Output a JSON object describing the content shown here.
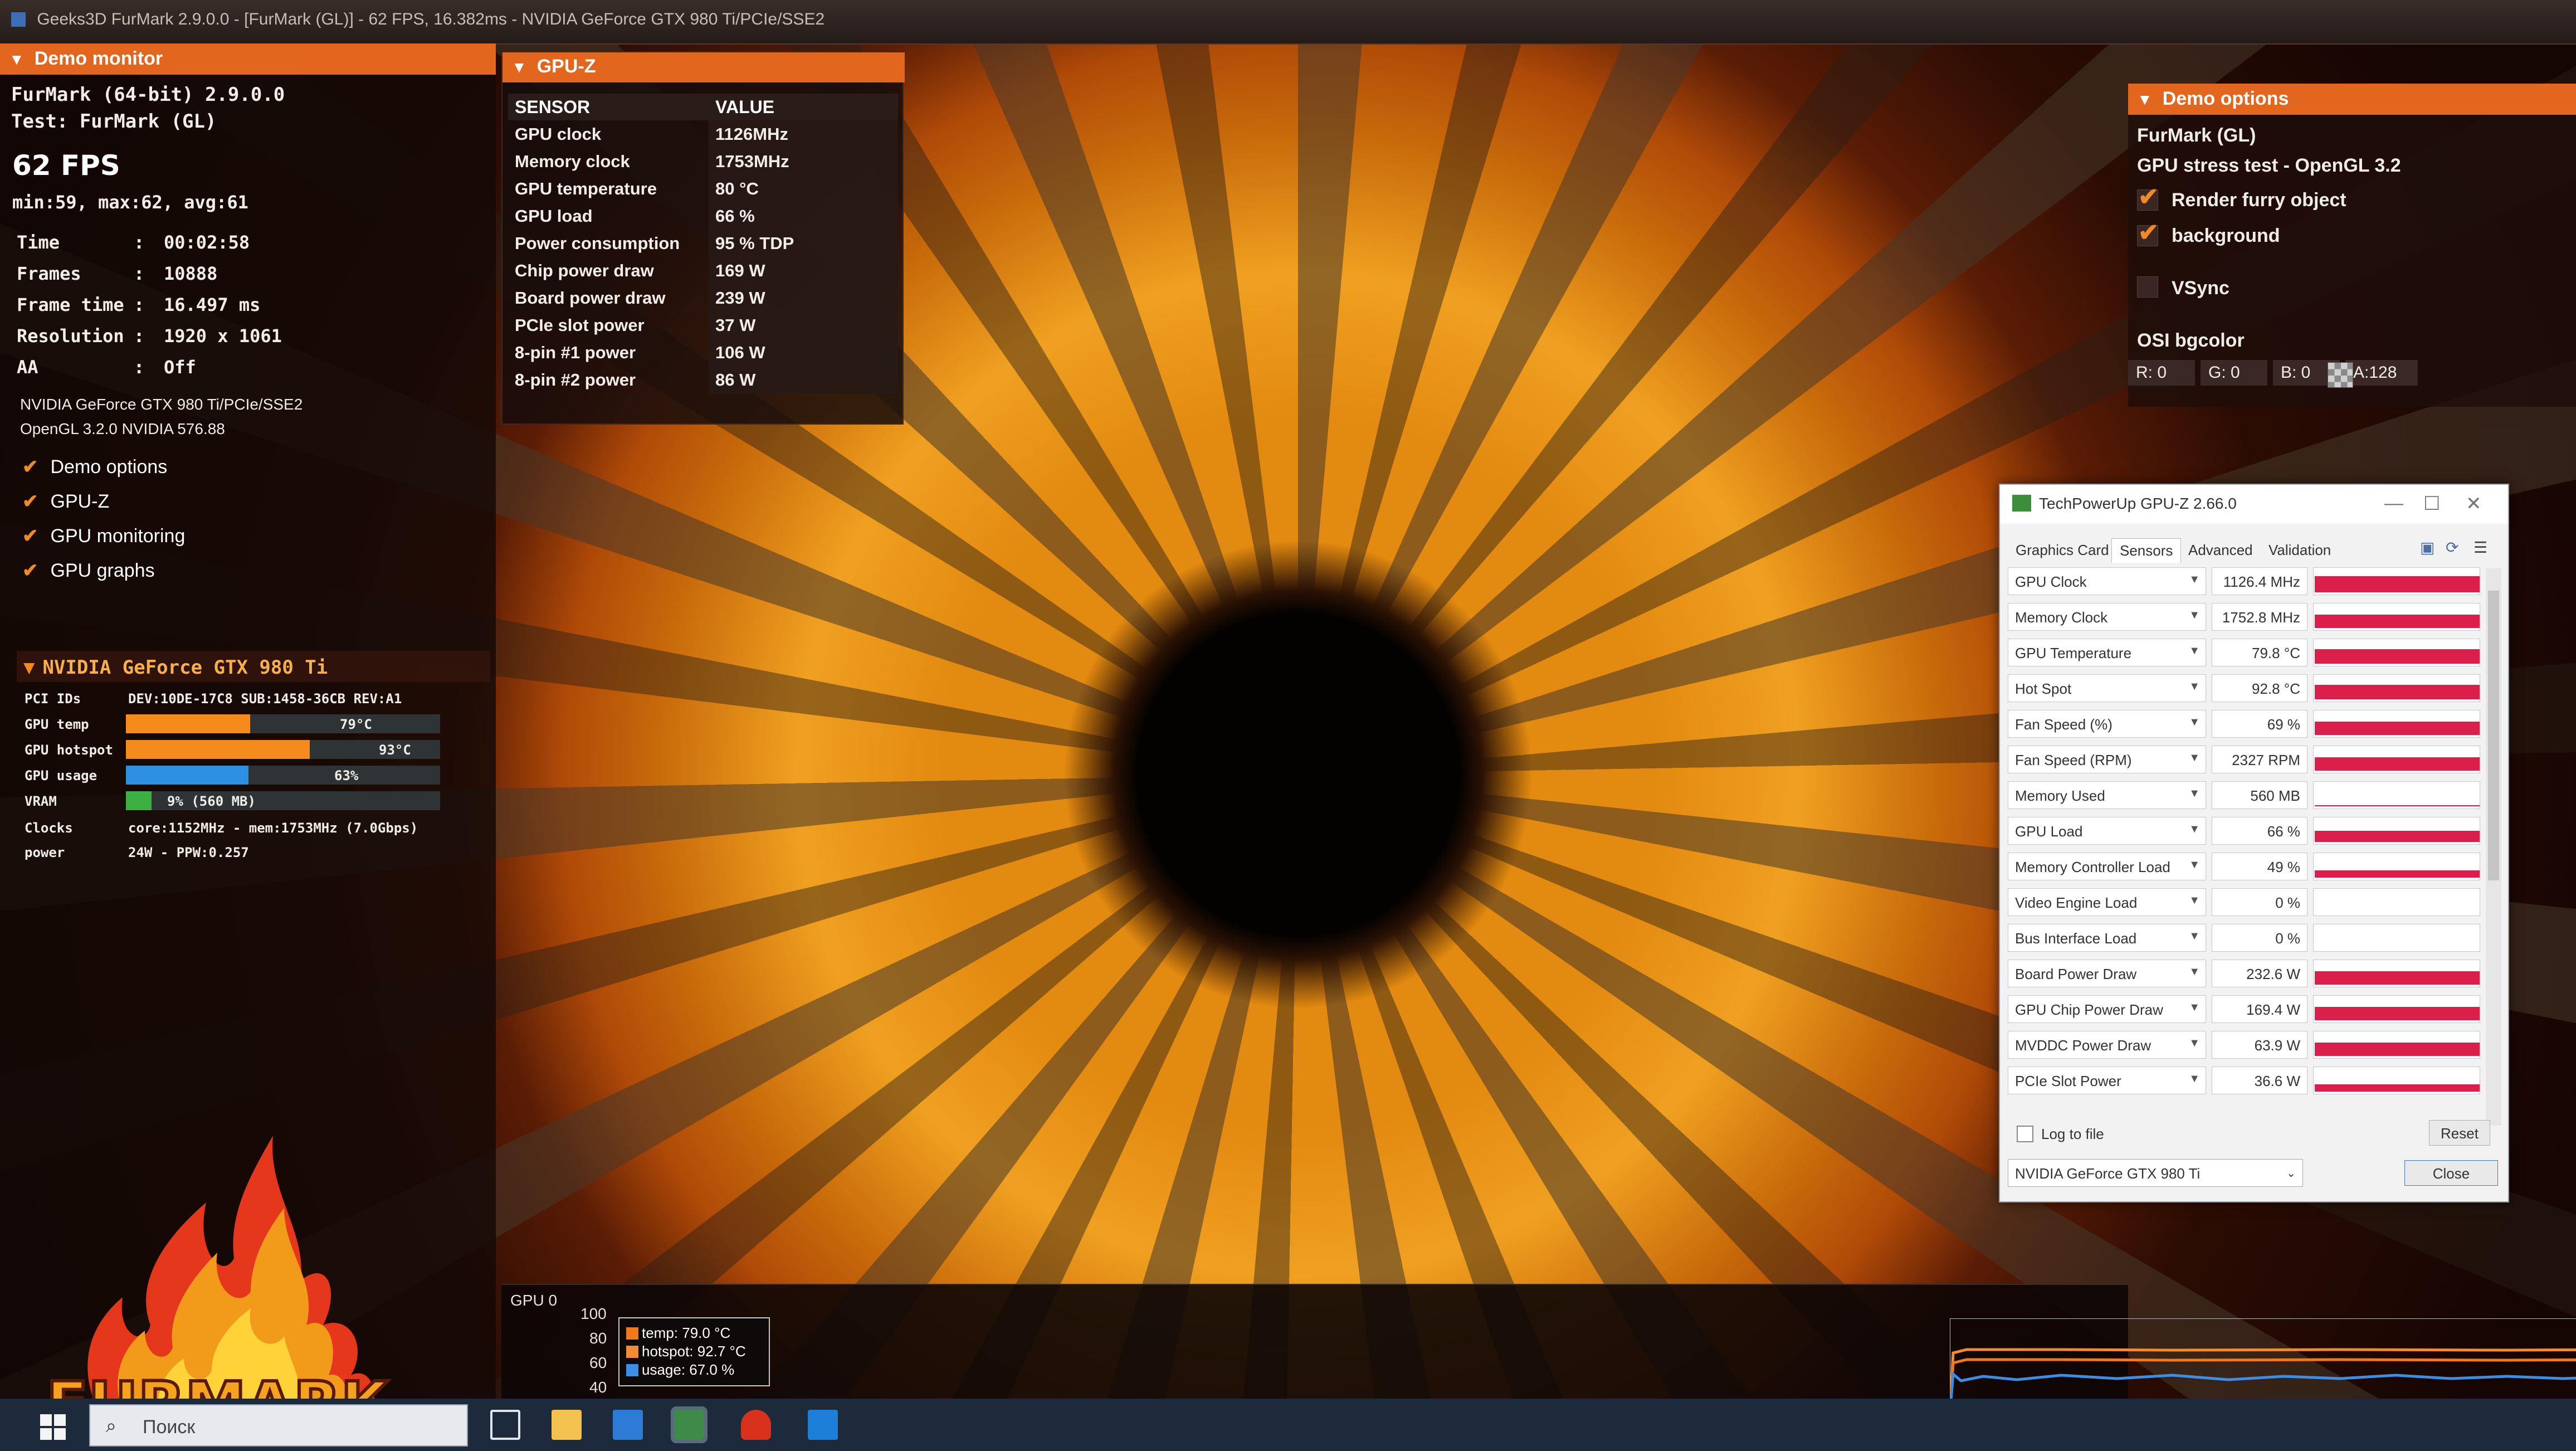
{
  "window": {
    "title": "Geeks3D FurMark 2.9.0.0 - [FurMark (GL)] - 62 FPS, 16.382ms - NVIDIA GeForce GTX 980 Ti/PCIe/SSE2"
  },
  "demo_monitor": {
    "header": "Demo monitor",
    "app_version": "FurMark (64-bit) 2.9.0.0",
    "test": "Test: FurMark (GL)",
    "fps": "62 FPS",
    "minmax": "min:59, max:62, avg:61",
    "stats": [
      {
        "label": "Time",
        "value": "00:02:58"
      },
      {
        "label": "Frames",
        "value": "10888"
      },
      {
        "label": "Frame time",
        "value": "16.497 ms"
      },
      {
        "label": "Resolution",
        "value": "1920 x 1061"
      },
      {
        "label": "AA",
        "value": "Off"
      }
    ],
    "renderer": "NVIDIA GeForce GTX 980 Ti/PCIe/SSE2",
    "opengl": "OpenGL 3.2.0 NVIDIA 576.88",
    "toggles": [
      {
        "label": "Demo options",
        "checked": true
      },
      {
        "label": "GPU-Z",
        "checked": true
      },
      {
        "label": "GPU monitoring",
        "checked": true
      },
      {
        "label": "GPU graphs",
        "checked": true
      }
    ],
    "gpu_header": "NVIDIA GeForce GTX 980 Ti",
    "gpu": {
      "pci_label": "PCI IDs",
      "pci_value": "DEV:10DE-17C8 SUB:1458-36CB REV:A1",
      "temp_label": "GPU temp",
      "temp_value": "79°C",
      "temp_fraction": 0.79,
      "hotspot_label": "GPU hotspot",
      "hotspot_value": "93°C",
      "hotspot_fraction": 0.93,
      "usage_label": "GPU usage",
      "usage_value": "63%",
      "usage_fraction": 0.63,
      "vram_label": "VRAM",
      "vram_value": "9% (560 MB)",
      "vram_fraction": 0.09,
      "clocks_label": "Clocks",
      "clocks_value": "core:1152MHz - mem:1753MHz (7.0Gbps)",
      "power_label": "power",
      "power_value": "24W - PPW:0.257"
    },
    "logo": "FURMARK"
  },
  "gpuz_overlay": {
    "header": "GPU-Z",
    "col_sensor": "SENSOR",
    "col_value": "VALUE",
    "rows": [
      {
        "k": "GPU clock",
        "v": "1126MHz"
      },
      {
        "k": "Memory clock",
        "v": "1753MHz"
      },
      {
        "k": "GPU temperature",
        "v": "80 °C"
      },
      {
        "k": "GPU load",
        "v": "66 %"
      },
      {
        "k": "Power consumption",
        "v": "95 % TDP"
      },
      {
        "k": "Chip power draw",
        "v": "169 W"
      },
      {
        "k": "Board power draw",
        "v": "239 W"
      },
      {
        "k": "PCIe slot power",
        "v": "37 W"
      },
      {
        "k": "8-pin #1 power",
        "v": "106 W"
      },
      {
        "k": "8-pin #2 power",
        "v": "86 W"
      }
    ]
  },
  "demo_options": {
    "header": "Demo options",
    "title": "FurMark (GL)",
    "subtitle": "GPU stress test - OpenGL 3.2",
    "render_furry": "Render furry object",
    "background": "background",
    "vsync": "VSync",
    "osi_label": "OSI bgcolor",
    "r": "R: 0",
    "g": "G: 0",
    "b": "B: 0",
    "a": "A:128"
  },
  "tpu": {
    "title": "TechPowerUp GPU-Z 2.66.0",
    "tabs": [
      "Graphics Card",
      "Sensors",
      "Advanced",
      "Validation"
    ],
    "active_tab": "Sensors",
    "sensors": [
      {
        "name": "GPU Clock",
        "value": "1126.4 MHz",
        "level": 0.65
      },
      {
        "name": "Memory Clock",
        "value": "1752.8 MHz",
        "level": 0.55
      },
      {
        "name": "GPU Temperature",
        "value": "79.8 °C",
        "level": 0.6
      },
      {
        "name": "Hot Spot",
        "value": "92.8 °C",
        "level": 0.6
      },
      {
        "name": "Fan Speed (%)",
        "value": "69 %",
        "level": 0.55
      },
      {
        "name": "Fan Speed (RPM)",
        "value": "2327 RPM",
        "level": 0.55
      },
      {
        "name": "Memory Used",
        "value": "560 MB",
        "level": 0.05
      },
      {
        "name": "GPU Load",
        "value": "66 %",
        "level": 0.45
      },
      {
        "name": "Memory Controller Load",
        "value": "49 %",
        "level": 0.3
      },
      {
        "name": "Video Engine Load",
        "value": "0 %",
        "level": 0.0
      },
      {
        "name": "Bus Interface Load",
        "value": "0 %",
        "level": 0.0
      },
      {
        "name": "Board Power Draw",
        "value": "232.6 W",
        "level": 0.55
      },
      {
        "name": "GPU Chip Power Draw",
        "value": "169.4 W",
        "level": 0.55
      },
      {
        "name": "MVDDC Power Draw",
        "value": "63.9 W",
        "level": 0.55
      },
      {
        "name": "PCIe Slot Power",
        "value": "36.6 W",
        "level": 0.3
      }
    ],
    "log_to_file": "Log to file",
    "reset": "Reset",
    "device": "NVIDIA GeForce GTX 980 Ti",
    "close": "Close"
  },
  "graph": {
    "label": "GPU 0",
    "yticks": [
      "100",
      "80",
      "60",
      "40"
    ],
    "legend": [
      {
        "text": "temp: 79.0 °C",
        "color": "#f07a1a"
      },
      {
        "text": "hotspot: 92.7 °C",
        "color": "#f08c30"
      },
      {
        "text": "usage: 67.0 %",
        "color": "#3a8ee6"
      }
    ]
  },
  "taskbar": {
    "search_placeholder": "Поиск"
  },
  "colors": {
    "accent": "#e3661f",
    "tpu_bar": "#d91f4a",
    "usage_bar": "#2d8fe0",
    "vram_bar": "#3cb043"
  }
}
